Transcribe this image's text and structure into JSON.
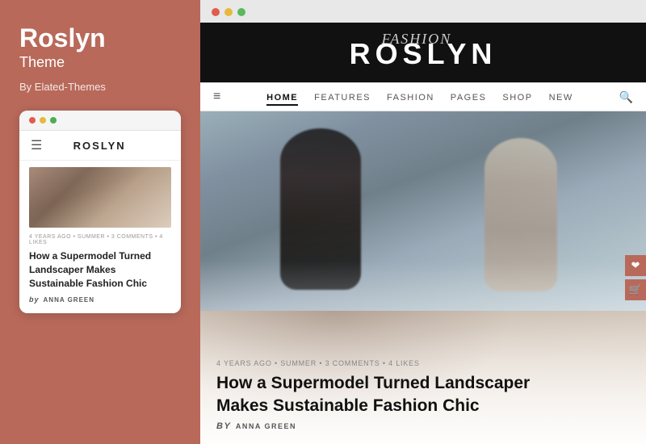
{
  "sidebar": {
    "title": "Roslyn",
    "subtitle": "Theme",
    "by": "By Elated-Themes"
  },
  "mobile_preview": {
    "dots": [
      "red",
      "yellow",
      "green"
    ],
    "logo": "ROSLYN",
    "article": {
      "meta": "4 YEARS AGO • SUMMER • 3 COMMENTS • 4 LIKES",
      "title": "How a Supermodel Turned Landscaper Makes Sustainable Fashion Chic",
      "author_prefix": "by",
      "author": "ANNA GREEN"
    }
  },
  "browser": {
    "dots": [
      "red",
      "yellow",
      "green"
    ]
  },
  "site_header": {
    "script_text": "Fashion",
    "logo": "ROSLYN"
  },
  "site_nav": {
    "hamburger": "≡",
    "links": [
      {
        "label": "HOME",
        "active": true
      },
      {
        "label": "FEATURES",
        "active": false
      },
      {
        "label": "FASHION",
        "active": false
      },
      {
        "label": "PAGES",
        "active": false
      },
      {
        "label": "SHOP",
        "active": false
      },
      {
        "label": "NEW",
        "active": false
      }
    ],
    "search_icon": "🔍"
  },
  "main_article": {
    "meta": "4 YEARS AGO • SUMMER • 3 COMMENTS • 4 LIKES",
    "title": "How a Supermodel Turned Landscaper Makes Sustainable Fashion Chic",
    "author_prefix": "by",
    "author": "ANNA GREEN"
  },
  "side_icons": {
    "icon1": "❤",
    "icon2": "🛒"
  }
}
